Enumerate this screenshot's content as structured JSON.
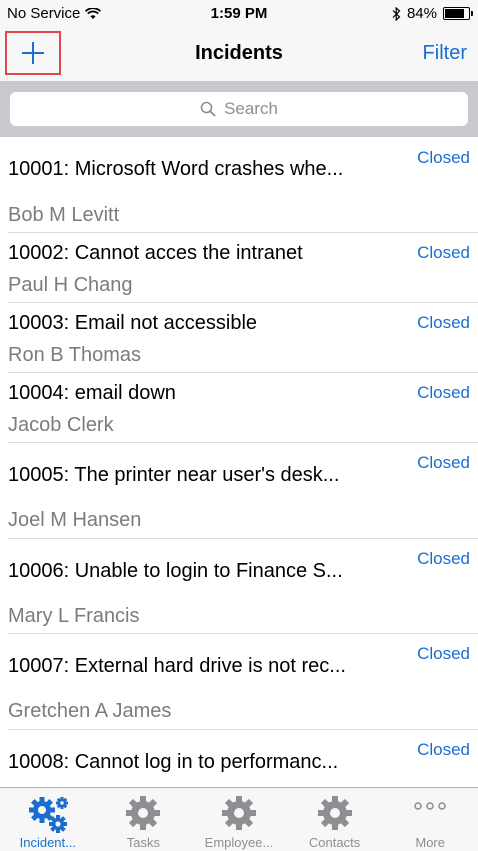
{
  "status_bar": {
    "carrier": "No Service",
    "time": "1:59 PM",
    "battery": "84%",
    "battery_level": 0.84
  },
  "nav": {
    "title": "Incidents",
    "filter_label": "Filter"
  },
  "search": {
    "placeholder": "Search"
  },
  "incidents": [
    {
      "title": "10001: Microsoft Word crashes whe...",
      "person": "Bob M Levitt",
      "status": "Closed"
    },
    {
      "title": "10002: Cannot acces the intranet",
      "person": "Paul H Chang",
      "status": "Closed"
    },
    {
      "title": "10003: Email not accessible",
      "person": "Ron B Thomas",
      "status": "Closed"
    },
    {
      "title": "10004: email down",
      "person": "Jacob Clerk",
      "status": "Closed"
    },
    {
      "title": "10005: The printer near user's desk...",
      "person": "Joel M Hansen",
      "status": "Closed"
    },
    {
      "title": "10006: Unable to login to Finance S...",
      "person": "Mary L Francis",
      "status": "Closed"
    },
    {
      "title": "10007: External hard drive is not rec...",
      "person": "Gretchen A James",
      "status": "Closed"
    },
    {
      "title": "10008: Cannot log in to performanc...",
      "person": "",
      "status": "Closed"
    }
  ],
  "tabs": [
    {
      "label": "Incident...",
      "icon": "gears-icon",
      "active": true
    },
    {
      "label": "Tasks",
      "icon": "gear-icon",
      "active": false
    },
    {
      "label": "Employee...",
      "icon": "gear-icon",
      "active": false
    },
    {
      "label": "Contacts",
      "icon": "gear-icon",
      "active": false
    },
    {
      "label": "More",
      "icon": "more-icon",
      "active": false
    }
  ],
  "colors": {
    "accent": "#1b6ecf",
    "highlight_border": "#e2474b",
    "inactive_icon": "#8e8e93"
  }
}
